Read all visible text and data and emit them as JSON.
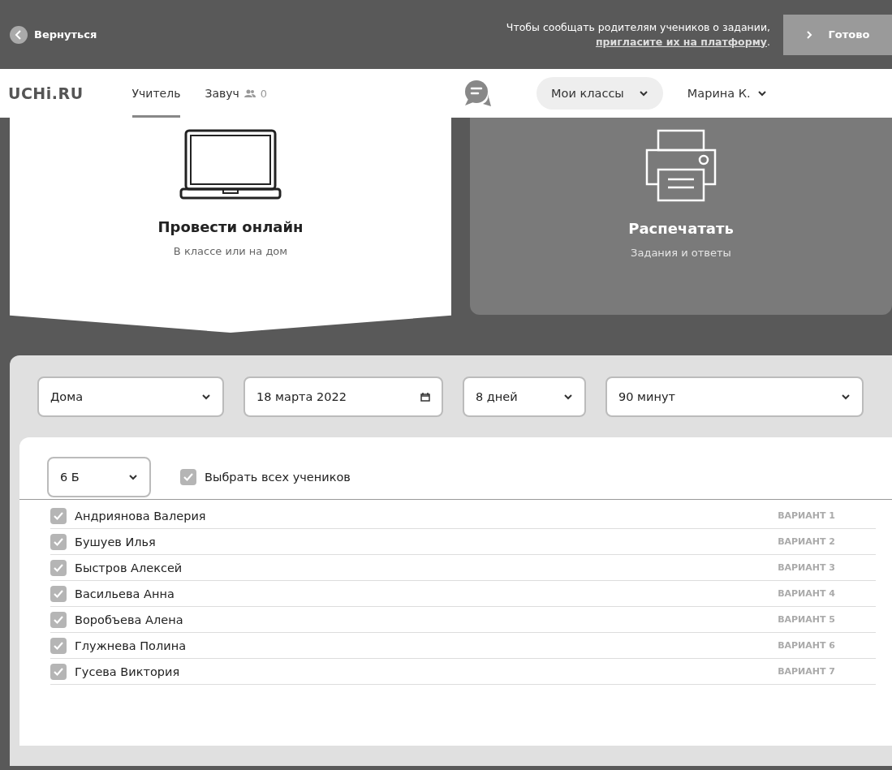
{
  "top_bar": {
    "back_label": "Вернуться",
    "notice": "Чтобы сообщать родителям учеников о задании, **пригласите их на платформу**.",
    "done_label": "Готово"
  },
  "header": {
    "logo": "UCHi.RU",
    "tabs": [
      {
        "label": "Учитель",
        "selected": true
      },
      {
        "label": "Завуч",
        "selected": false,
        "count": "0"
      }
    ],
    "classes_label": "Мои классы",
    "user": "Марина К."
  },
  "modes": [
    {
      "kind": "laptop",
      "title": "Провести онлайн",
      "subtitle": "В классе или на дом",
      "selected": true
    },
    {
      "kind": "printer",
      "title": "Распечатать",
      "subtitle": "Задания и ответы",
      "selected": false
    }
  ],
  "filters": [
    {
      "kind": "select",
      "value": "Дома"
    },
    {
      "kind": "date",
      "value": "18 марта 2022"
    },
    {
      "kind": "select",
      "value": "8 дней"
    },
    {
      "kind": "select",
      "value": "90 минут"
    }
  ],
  "class_select": "6 Б",
  "select_all": {
    "label": "Выбрать всех учеников",
    "checked": true
  },
  "students": [
    {
      "name": "Андриянова Валерия",
      "variant": "ВАРИАНТ 1",
      "checked": true
    },
    {
      "name": "Бушуев Илья",
      "variant": "ВАРИАНТ 2",
      "checked": true
    },
    {
      "name": "Быстров Алексей",
      "variant": "ВАРИАНТ 3",
      "checked": true
    },
    {
      "name": "Васильева Анна",
      "variant": "ВАРИАНТ 4",
      "checked": true
    },
    {
      "name": "Воробъева Алена",
      "variant": "ВАРИАНТ 5",
      "checked": true
    },
    {
      "name": "Глужнева Полина",
      "variant": "ВАРИАНТ 6",
      "checked": true
    },
    {
      "name": "Гусева Виктория",
      "variant": "ВАРИАНТ 7",
      "checked": true
    }
  ]
}
